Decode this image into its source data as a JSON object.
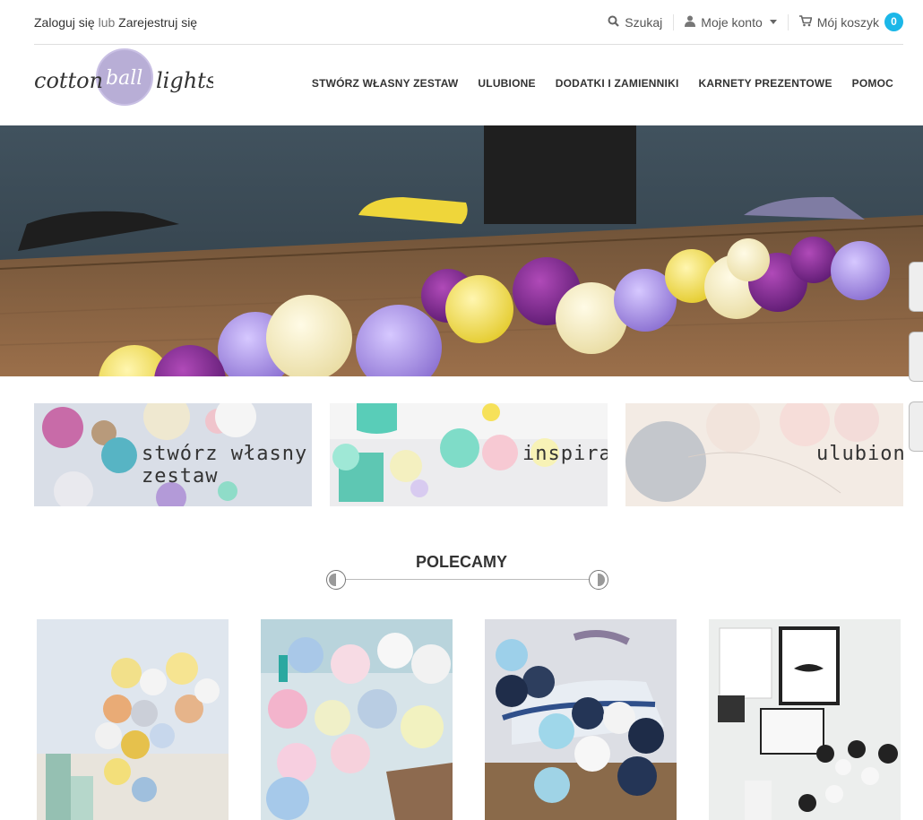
{
  "topbar": {
    "login_label": "Zaloguj się",
    "or_label": "lub",
    "register_label": "Zarejestruj się",
    "search_label": "Szukaj",
    "account_label": "Moje konto",
    "cart_label": "Mój koszyk",
    "cart_count": "0"
  },
  "brand": {
    "logo_text_1": "cotton",
    "logo_text_2": "ball",
    "logo_text_3": "lights"
  },
  "nav": {
    "items": [
      {
        "label": "STWÓRZ WŁASNY ZESTAW"
      },
      {
        "label": "ULUBIONE"
      },
      {
        "label": "DODATKI I ZAMIENNIKI"
      },
      {
        "label": "KARNETY PREZENTOWE"
      },
      {
        "label": "POMOC"
      }
    ]
  },
  "banners": [
    {
      "label": "stwórz własny zestaw"
    },
    {
      "label": "inspiracje"
    },
    {
      "label": "ulubione"
    }
  ],
  "section": {
    "title": "POLECAMY"
  },
  "colors": {
    "accent": "#1bb7e8",
    "divider": "#dedede",
    "text": "#333333"
  }
}
